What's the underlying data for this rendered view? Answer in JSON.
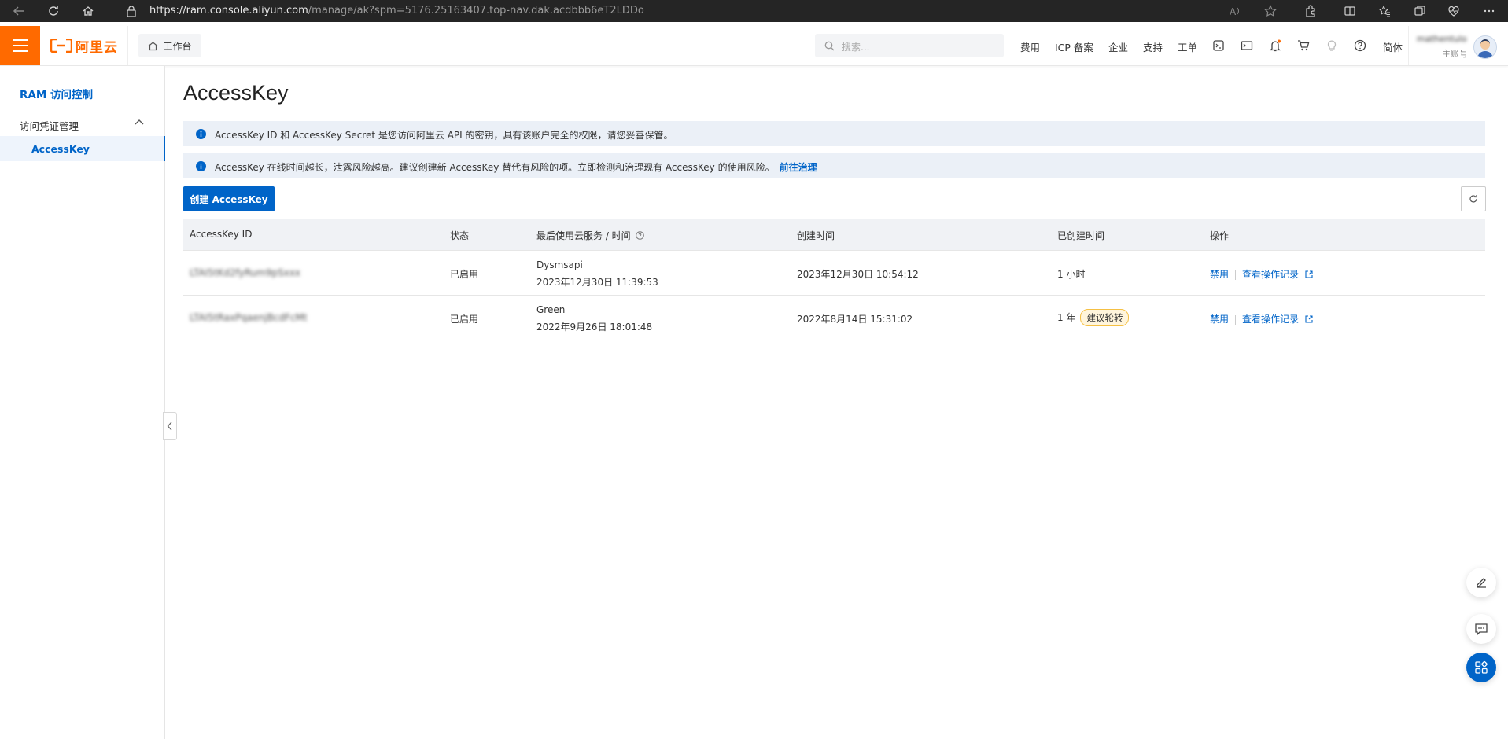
{
  "browser": {
    "url_host": "https://ram.console.aliyun.com",
    "url_path": "/manage/ak?spm=5176.25163407.top-nav.dak.acdbbb6eT2LDDo"
  },
  "topnav": {
    "logo_text": "阿里云",
    "workbench_label": "工作台",
    "search_placeholder": "搜索...",
    "links": [
      "费用",
      "ICP 备案",
      "企业",
      "支持",
      "工单"
    ],
    "lang": "简体",
    "user_name": "mathentulo",
    "user_role": "主账号",
    "brand_color": "#ff6a00"
  },
  "sidebar": {
    "title": "RAM 访问控制",
    "group": "访问凭证管理",
    "items": [
      {
        "label": "AccessKey"
      }
    ]
  },
  "main": {
    "title": "AccessKey",
    "alerts": [
      {
        "text": "AccessKey ID 和 AccessKey Secret 是您访问阿里云 API 的密钥，具有该账户完全的权限，请您妥善保管。"
      },
      {
        "text": "AccessKey 在线时间越长，泄露风险越高。建议创建新 AccessKey 替代有风险的项。立即检测和治理现有 AccessKey 的使用风险。",
        "link": "前往治理"
      }
    ],
    "create_button": "创建 AccessKey",
    "table": {
      "columns": [
        "AccessKey ID",
        "状态",
        "最后使用云服务 / 时间",
        "创建时间",
        "已创建时间",
        "操作"
      ],
      "rows": [
        {
          "id": "LTAI5tKd2fyRum9pSxxx",
          "status": "已启用",
          "service": "Dysmsapi",
          "last_used": "2023年12月30日 11:39:53",
          "created": "2023年12月30日 10:54:12",
          "age": "1 小时",
          "tag": "",
          "action_disable": "禁用",
          "action_log": "查看操作记录"
        },
        {
          "id": "LTAI5tRaxPqaenjBcdFcMt",
          "status": "已启用",
          "service": "Green",
          "last_used": "2022年9月26日 18:01:48",
          "created": "2022年8月14日 15:31:02",
          "age": "1 年",
          "tag": "建议轮转",
          "action_disable": "禁用",
          "action_log": "查看操作记录"
        }
      ]
    }
  }
}
